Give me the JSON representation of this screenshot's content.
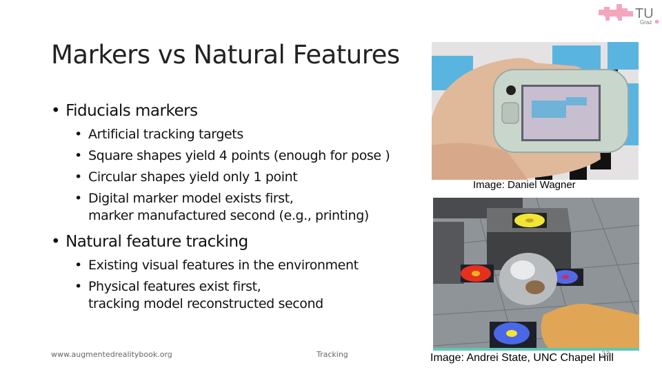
{
  "logo": {
    "text": "TU",
    "subtext": "Graz",
    "color": "#f4a6bd"
  },
  "slide": {
    "title": "Markers vs Natural Features",
    "bullets": [
      {
        "text": "Fiducials markers",
        "sub": [
          "Artificial tracking targets",
          "Square shapes yield 4 points (enough for pose )",
          "Circular shapes yield only 1 point",
          "Digital marker model exists first,\nmarker manufactured second (e.g., printing)"
        ]
      },
      {
        "text": "Natural feature tracking",
        "sub": [
          "Existing visual features in the environment",
          "Physical features exist first,\ntracking model reconstructed second"
        ]
      }
    ],
    "bullet_glyph": "•"
  },
  "images": [
    {
      "caption": "Image: Daniel Wagner",
      "depicts": "hand holding handheld AR device over fiducial markers and blue blocks"
    },
    {
      "caption": "Image: Andrei State, UNC Chapel Hill",
      "depicts": "reflective teapot on table with circular colored markers and a hand"
    }
  ],
  "footer": {
    "website": "www.augmentedrealitybook.org",
    "section": "Tracking",
    "page_number": "32"
  }
}
